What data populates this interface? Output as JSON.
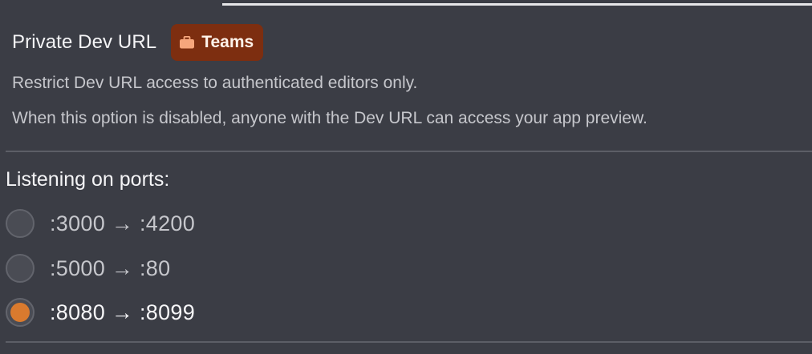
{
  "private_dev_url": {
    "title": "Private Dev URL",
    "badge": {
      "label": "Teams",
      "icon": "briefcase-icon",
      "color": "#7d2e10"
    },
    "description_1": "Restrict Dev URL access to authenticated editors only.",
    "description_2": "When this option is disabled, anyone with the Dev URL can access your app preview."
  },
  "ports": {
    "heading": "Listening on ports:",
    "selected_color": "#d97a2e",
    "items": [
      {
        "label": ":3000 → :4200",
        "selected": false
      },
      {
        "label": ":5000 → :80",
        "selected": false
      },
      {
        "label": ":8080 → :8099",
        "selected": true
      }
    ]
  }
}
